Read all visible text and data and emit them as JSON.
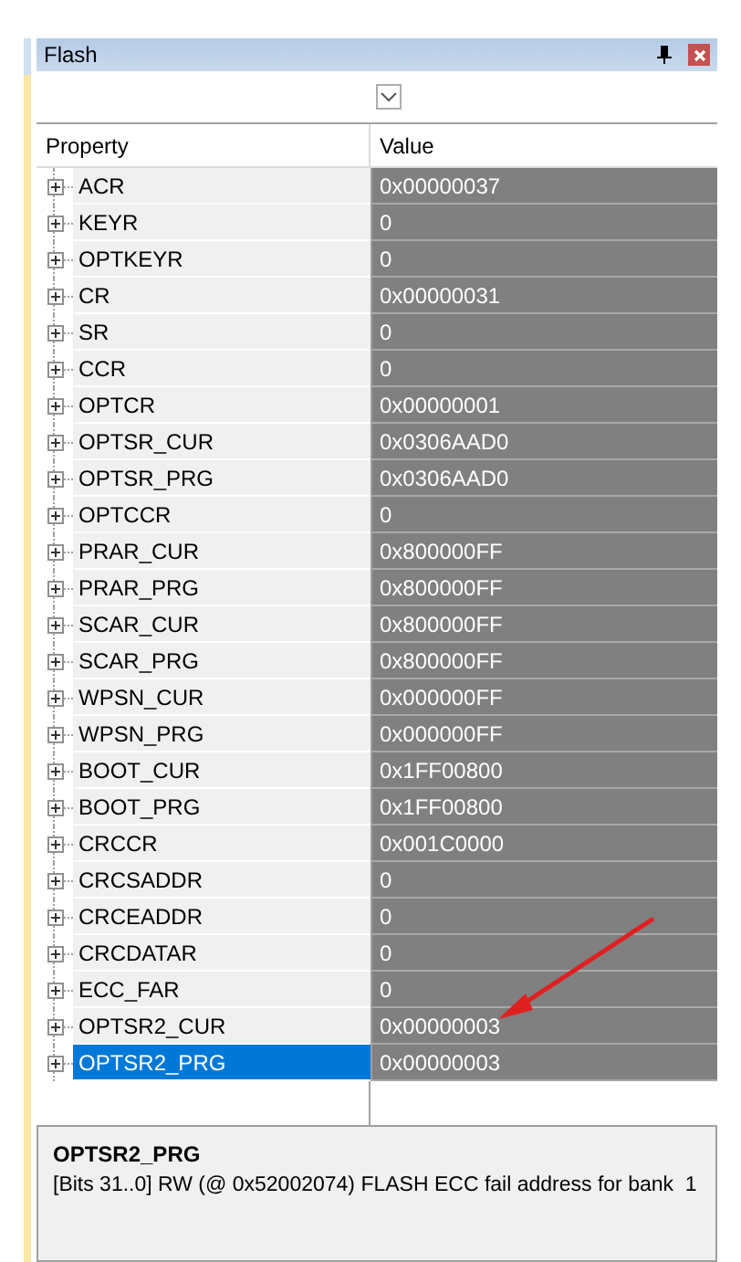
{
  "window": {
    "title": "Flash"
  },
  "table": {
    "columns": [
      "Property",
      "Value"
    ],
    "rows": [
      {
        "property": "ACR",
        "value": "0x00000037",
        "expanded": false,
        "selected": false
      },
      {
        "property": "KEYR",
        "value": "0",
        "expanded": false,
        "selected": false
      },
      {
        "property": "OPTKEYR",
        "value": "0",
        "expanded": false,
        "selected": false
      },
      {
        "property": "CR",
        "value": "0x00000031",
        "expanded": false,
        "selected": false
      },
      {
        "property": "SR",
        "value": "0",
        "expanded": false,
        "selected": false
      },
      {
        "property": "CCR",
        "value": "0",
        "expanded": false,
        "selected": false
      },
      {
        "property": "OPTCR",
        "value": "0x00000001",
        "expanded": false,
        "selected": false
      },
      {
        "property": "OPTSR_CUR",
        "value": "0x0306AAD0",
        "expanded": false,
        "selected": false
      },
      {
        "property": "OPTSR_PRG",
        "value": "0x0306AAD0",
        "expanded": false,
        "selected": false
      },
      {
        "property": "OPTCCR",
        "value": "0",
        "expanded": false,
        "selected": false
      },
      {
        "property": "PRAR_CUR",
        "value": "0x800000FF",
        "expanded": false,
        "selected": false
      },
      {
        "property": "PRAR_PRG",
        "value": "0x800000FF",
        "expanded": false,
        "selected": false
      },
      {
        "property": "SCAR_CUR",
        "value": "0x800000FF",
        "expanded": false,
        "selected": false
      },
      {
        "property": "SCAR_PRG",
        "value": "0x800000FF",
        "expanded": false,
        "selected": false
      },
      {
        "property": "WPSN_CUR",
        "value": "0x000000FF",
        "expanded": false,
        "selected": false
      },
      {
        "property": "WPSN_PRG",
        "value": "0x000000FF",
        "expanded": false,
        "selected": false
      },
      {
        "property": "BOOT_CUR",
        "value": "0x1FF00800",
        "expanded": false,
        "selected": false
      },
      {
        "property": "BOOT_PRG",
        "value": "0x1FF00800",
        "expanded": false,
        "selected": false
      },
      {
        "property": "CRCCR",
        "value": "0x001C0000",
        "expanded": false,
        "selected": false
      },
      {
        "property": "CRCSADDR",
        "value": "0",
        "expanded": false,
        "selected": false
      },
      {
        "property": "CRCEADDR",
        "value": "0",
        "expanded": false,
        "selected": false
      },
      {
        "property": "CRCDATAR",
        "value": "0",
        "expanded": false,
        "selected": false
      },
      {
        "property": "ECC_FAR",
        "value": "0",
        "expanded": false,
        "selected": false
      },
      {
        "property": "OPTSR2_CUR",
        "value": "0x00000003",
        "expanded": false,
        "selected": false
      },
      {
        "property": "OPTSR2_PRG",
        "value": "0x00000003",
        "expanded": false,
        "selected": true
      }
    ]
  },
  "description": {
    "title": "OPTSR2_PRG",
    "text": "[Bits 31..0] RW (@ 0x52002074) FLASH ECC fail address for bank  1"
  }
}
